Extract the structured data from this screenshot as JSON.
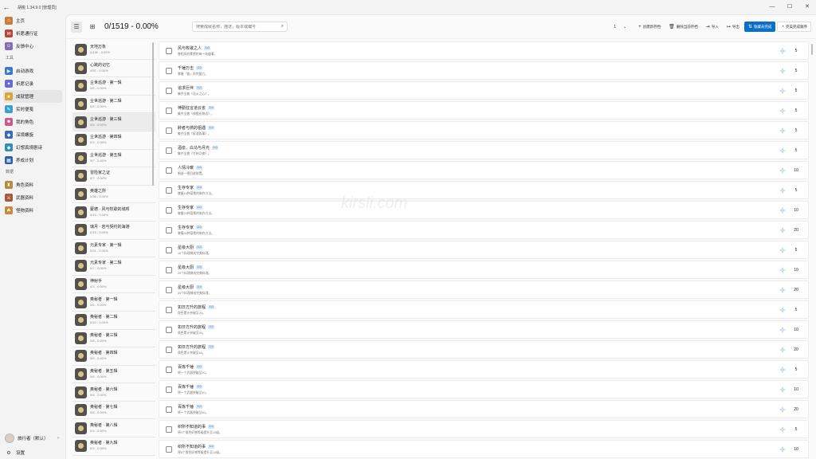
{
  "window": {
    "title": "胡桃 1.34.9.0 [管理员]"
  },
  "nav": {
    "items1": [
      {
        "label": "主页",
        "color": "#c97b3a",
        "glyph": "⌂"
      },
      {
        "label": "祈愿通行证",
        "color": "#b5473a",
        "glyph": "✉"
      },
      {
        "label": "反馈中心",
        "color": "#8a6bb5",
        "glyph": "☺"
      }
    ],
    "section_tools": "工具",
    "items2": [
      {
        "label": "启动游戏",
        "color": "#3a7bc9",
        "glyph": "▶"
      },
      {
        "label": "祈愿记录",
        "color": "#6a6ad0",
        "glyph": "✦"
      },
      {
        "label": "成就管理",
        "color": "#d9a43a",
        "glyph": "★"
      },
      {
        "label": "实时便笺",
        "color": "#3aa0c9",
        "glyph": "✎"
      },
      {
        "label": "我的角色",
        "color": "#c95a8a",
        "glyph": "☻"
      },
      {
        "label": "深境螺旋",
        "color": "#3a6bb5",
        "glyph": "◆"
      },
      {
        "label": "幻想真境剧诗",
        "color": "#2f8fb5",
        "glyph": "◆"
      },
      {
        "label": "养成计划",
        "color": "#2f5fa8",
        "glyph": "▦"
      }
    ],
    "section_data": "数据",
    "items3": [
      {
        "label": "角色资料",
        "color": "#b58a3a",
        "glyph": "♜"
      },
      {
        "label": "武器资料",
        "color": "#a8583a",
        "glyph": "⚔"
      },
      {
        "label": "怪物资料",
        "color": "#c98a3a",
        "glyph": "☘"
      }
    ],
    "profile_name": "旅行者（默认）",
    "settings_label": "设置"
  },
  "toolbar": {
    "summary": "0/1519 - 0.00%",
    "search_placeholder": "搜索成就名称，描述，版本或编号",
    "page": "1",
    "create_label": "创建新存档",
    "delete_label": "删除当前存档",
    "import_label": "导入",
    "export_label": "导出",
    "hide_done_label": "隐藏未完成",
    "sort_label": "完美完成顺序"
  },
  "categories": [
    {
      "name": "天地万象",
      "progress": "0/190 - 0.00%"
    },
    {
      "name": "心跳的记忆",
      "progress": "0/57 - 0.00%"
    },
    {
      "name": "尘世巡游 · 第一辑",
      "progress": "0/6 - 0.00%"
    },
    {
      "name": "尘世巡游 · 第二辑",
      "progress": "0/5 - 0.00%"
    },
    {
      "name": "尘世巡游 · 第三辑",
      "progress": "0/4 - 0.00%"
    },
    {
      "name": "尘世巡游 · 第四辑",
      "progress": "0/4 - 0.00%"
    },
    {
      "name": "尘世巡游 · 第五辑",
      "progress": "0/7 - 0.00%"
    },
    {
      "name": "冒险家之证",
      "progress": "0/7 - 0.00%"
    },
    {
      "name": "英雄之所",
      "progress": "0/36 - 0.00%"
    },
    {
      "name": "蒙德 · 风与牧歌的城邦",
      "progress": "0/13 - 0.00%"
    },
    {
      "name": "璃月 · 岩与契约的海港",
      "progress": "0/15 - 0.00%"
    },
    {
      "name": "元素专家 · 第一辑",
      "progress": "0/21 - 0.00%"
    },
    {
      "name": "元素专家 · 第二辑",
      "progress": "0/7 - 0.00%"
    },
    {
      "name": "神射手",
      "progress": "0/3 - 0.00%"
    },
    {
      "name": "奥秘者 · 第一辑",
      "progress": "0/4 - 0.00%"
    },
    {
      "name": "奥秘者 · 第二辑",
      "progress": "0/10 - 0.00%"
    },
    {
      "name": "奥秘者 · 第三辑",
      "progress": "0/8 - 0.00%"
    },
    {
      "name": "奥秘者 · 第四辑",
      "progress": "0/9 - 0.00%"
    },
    {
      "name": "奥秘者 · 第五辑",
      "progress": "0/6 - 0.00%"
    },
    {
      "name": "奥秘者 · 第六辑",
      "progress": "0/6 - 0.00%"
    },
    {
      "name": "奥秘者 · 第七辑",
      "progress": "0/6 - 0.00%"
    },
    {
      "name": "奥秘者 · 第八辑",
      "progress": "0/4 - 0.00%"
    },
    {
      "name": "奥秘者 · 第九辑",
      "progress": "0/4 - 0.00%"
    }
  ],
  "achievements": [
    {
      "title": "风与牧歌之人",
      "version": "1.0",
      "desc": "曾相风的蒙德的每一场盛事。",
      "reward": "5"
    },
    {
      "title": "千锤万击",
      "version": "1.0",
      "desc": "掌握「锻」的完整力。",
      "reward": "5"
    },
    {
      "title": "追求巨伴",
      "version": "1.0",
      "desc": "集齐全套《浴火之心》。",
      "reward": "5"
    },
    {
      "title": "神勤狂言道云雀",
      "version": "1.0",
      "desc": "集齐全套《神霞拓物语》。",
      "reward": "5"
    },
    {
      "title": "醉者与燃的祖遇",
      "version": "1.0",
      "desc": "集齐全套《醉酒叙事》。",
      "reward": "5"
    },
    {
      "title": "酒泉、白马与月光",
      "version": "1.0",
      "desc": "集齐全套《竹林月夜》。",
      "reward": "5"
    },
    {
      "title": "人情冷暖",
      "version": "1.0",
      "desc": "制造一把回收装置。",
      "reward": "10"
    },
    {
      "title": "生存专家",
      "version": "1.0",
      "desc": "掌握10种菜肴的制作方法。",
      "reward": "5"
    },
    {
      "title": "生存专家",
      "version": "1.0",
      "desc": "掌握20种菜肴的制作方法。",
      "reward": "10"
    },
    {
      "title": "生存专家",
      "version": "1.0",
      "desc": "掌握40种菜肴的制作方法。",
      "reward": "20"
    },
    {
      "title": "星级大厨",
      "version": "1.0",
      "desc": "10个料理做成完美料理。",
      "reward": "5"
    },
    {
      "title": "星级大厨",
      "version": "1.0",
      "desc": "20个料理做成完美料理。",
      "reward": "10"
    },
    {
      "title": "星级大厨",
      "version": "1.0",
      "desc": "40个料理做成完美料理。",
      "reward": "20"
    },
    {
      "title": "如日方升的旅程",
      "version": "1.0",
      "desc": "角色累计突破至20。",
      "reward": "5"
    },
    {
      "title": "如日方升的旅程",
      "version": "1.0",
      "desc": "角色累计突破至40。",
      "reward": "10"
    },
    {
      "title": "如日方升的旅程",
      "version": "1.0",
      "desc": "角色累计突破至60。",
      "reward": "20"
    },
    {
      "title": "百炼千锤",
      "version": "1.0",
      "desc": "将一个武器突破至20。",
      "reward": "5"
    },
    {
      "title": "百炼千锤",
      "version": "1.0",
      "desc": "将一个武器突破至40。",
      "reward": "10"
    },
    {
      "title": "百炼千锤",
      "version": "1.0",
      "desc": "将一个武器突破至60。",
      "reward": "20"
    },
    {
      "title": "织所不知道的事",
      "version": "1.0",
      "desc": "将4个角色好感等级提升至10级。",
      "reward": "5"
    },
    {
      "title": "织所不知道的事",
      "version": "1.0",
      "desc": "将8个角色好感等级提升至10级。",
      "reward": "10"
    }
  ],
  "colors": {
    "accent": "#0b6fc8",
    "version_badge": "#d6e7f7"
  }
}
